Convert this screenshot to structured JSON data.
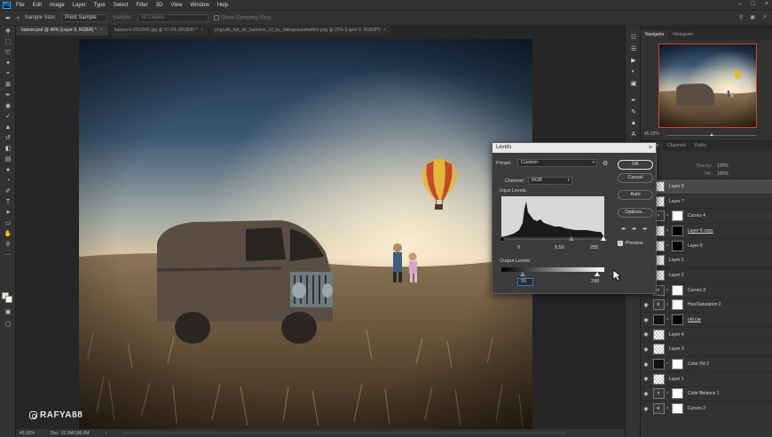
{
  "menubar": {
    "logo": "Ps",
    "items": [
      "File",
      "Edit",
      "Image",
      "Layer",
      "Type",
      "Select",
      "Filter",
      "3D",
      "View",
      "Window",
      "Help"
    ]
  },
  "options": {
    "sample_size_label": "Sample Size:",
    "sample_size_value": "Point Sample",
    "sample_label": "Sample:",
    "sample_value": "All Layers",
    "sampling_ring_label": "Show Sampling Ring"
  },
  "tabs": [
    {
      "label": "baloon.psd @ 45% (Layer 9, RGB/8) *",
      "active": true
    },
    {
      "label": "baloon-k-1562041.jpg @ 97.6% (RGB/8) *",
      "active": false
    },
    {
      "label": "pngcafe_hot_air_balloons_13_by_fakingsoundnotfon.png @ 25% (Layer 0, RGB/8*)",
      "active": false
    }
  ],
  "statusbar": {
    "zoom": "45.02%",
    "doc": "Doc: 15.3M/186.9M"
  },
  "watermark": {
    "text": "RAFYA88"
  },
  "navigator": {
    "tabs": [
      "Navigator",
      "Histogram"
    ],
    "zoom": "45.02%"
  },
  "layers_panel": {
    "tabs": [
      "Layers",
      "Channels",
      "Paths"
    ],
    "opacity_label": "Opacity:",
    "opacity_value": "100%",
    "fill_label": "Fill:",
    "fill_value": "100%",
    "layers": [
      {
        "name": "Layer 9",
        "thumb": "checker",
        "mask": "",
        "selected": true,
        "visible": false,
        "clip": false,
        "underline": false
      },
      {
        "name": "Layer 7",
        "thumb": "checker",
        "mask": "",
        "selected": false,
        "visible": false,
        "clip": false,
        "underline": false
      },
      {
        "name": "Curves 4",
        "thumb": "adj",
        "mask": "white",
        "selected": false,
        "visible": false,
        "clip": false,
        "underline": false
      },
      {
        "name": "Layer 6 copy",
        "thumb": "checker",
        "mask": "black",
        "selected": false,
        "visible": false,
        "clip": false,
        "underline": true
      },
      {
        "name": "Layer 6",
        "thumb": "checker",
        "mask": "black",
        "selected": false,
        "visible": false,
        "clip": false,
        "underline": false
      },
      {
        "name": "Layer 5",
        "thumb": "checker",
        "mask": "",
        "selected": false,
        "visible": false,
        "clip": false,
        "underline": false
      },
      {
        "name": "Layer 2",
        "thumb": "checker",
        "mask": "",
        "selected": false,
        "visible": false,
        "clip": false,
        "underline": false
      },
      {
        "name": "Curves 3",
        "thumb": "adj",
        "mask": "white",
        "selected": false,
        "visible": true,
        "clip": true,
        "underline": false
      },
      {
        "name": "Hue/Saturation 2",
        "thumb": "adj",
        "mask": "white",
        "selected": false,
        "visible": true,
        "clip": true,
        "underline": false
      },
      {
        "name": "old car",
        "thumb": "dark",
        "mask": "black",
        "selected": false,
        "visible": true,
        "clip": false,
        "underline": true
      },
      {
        "name": "Layer 4",
        "thumb": "checker",
        "mask": "",
        "selected": false,
        "visible": true,
        "clip": false,
        "underline": false
      },
      {
        "name": "Layer 3",
        "thumb": "checker",
        "mask": "",
        "selected": false,
        "visible": true,
        "clip": false,
        "underline": false
      },
      {
        "name": "Color Fill 2",
        "thumb": "dark",
        "mask": "white",
        "selected": false,
        "visible": true,
        "clip": false,
        "underline": false
      },
      {
        "name": "Layer 1",
        "thumb": "checker",
        "mask": "",
        "selected": false,
        "visible": true,
        "clip": false,
        "underline": false
      },
      {
        "name": "Color Balance 1",
        "thumb": "adj",
        "mask": "white",
        "selected": false,
        "visible": true,
        "clip": false,
        "underline": false
      },
      {
        "name": "Curves 2",
        "thumb": "adj",
        "mask": "white",
        "selected": false,
        "visible": true,
        "clip": true,
        "underline": false
      }
    ]
  },
  "levels": {
    "title": "Levels",
    "preset_label": "Preset:",
    "preset_value": "Custom",
    "channel_label": "Channel:",
    "channel_value": "RGB",
    "input_label": "Input Levels:",
    "input_black": "0",
    "input_gamma": "0,50",
    "input_white": "255",
    "output_label": "Output Levels:",
    "output_black": "55",
    "output_white": "248",
    "ok": "OK",
    "cancel": "Cancel",
    "auto": "Auto",
    "options": "Options...",
    "preview": "Preview",
    "preview_checked": true
  }
}
